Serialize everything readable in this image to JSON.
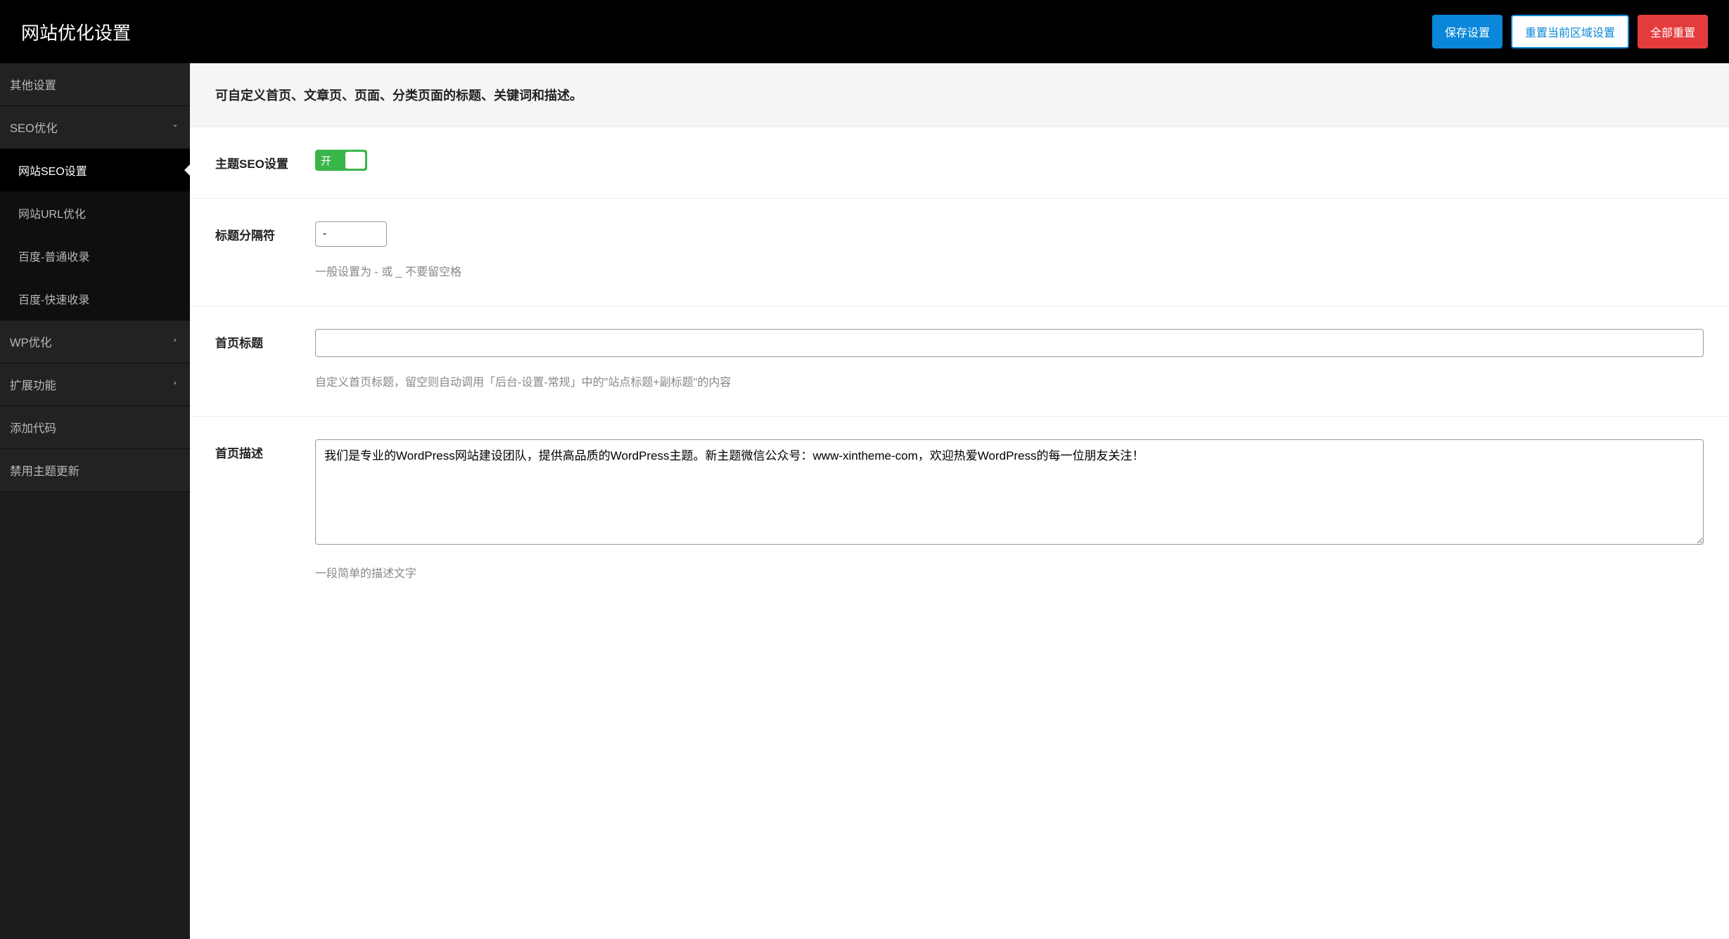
{
  "header": {
    "title": "网站优化设置",
    "actions": {
      "save": "保存设置",
      "reset_section": "重置当前区域设置",
      "reset_all": "全部重置"
    }
  },
  "sidebar": {
    "items": [
      {
        "label": "其他设置",
        "type": "item"
      },
      {
        "label": "SEO优化",
        "type": "expandable",
        "expanded": true
      },
      {
        "label": "网站SEO设置",
        "type": "subitem",
        "active": true
      },
      {
        "label": "网站URL优化",
        "type": "subitem"
      },
      {
        "label": "百度-普通收录",
        "type": "subitem"
      },
      {
        "label": "百度-快速收录",
        "type": "subitem"
      },
      {
        "label": "WP优化",
        "type": "expandable",
        "expanded": false
      },
      {
        "label": "扩展功能",
        "type": "expandable",
        "expanded": false
      },
      {
        "label": "添加代码",
        "type": "item"
      },
      {
        "label": "禁用主题更新",
        "type": "item"
      }
    ]
  },
  "content": {
    "intro": "可自定义首页、文章页、页面、分类页面的标题、关键词和描述。",
    "theme_seo": {
      "label": "主题SEO设置",
      "toggle_state": "开"
    },
    "title_separator": {
      "label": "标题分隔符",
      "value": "-",
      "help": "一般设置为 - 或 _ 不要留空格"
    },
    "home_title": {
      "label": "首页标题",
      "value": "",
      "help": "自定义首页标题，留空则自动调用「后台-设置-常规」中的\"站点标题+副标题\"的内容"
    },
    "home_description": {
      "label": "首页描述",
      "value": "我们是专业的WordPress网站建设团队，提供高品质的WordPress主题。新主题微信公众号：www-xintheme-com，欢迎热爱WordPress的每一位朋友关注！",
      "help": "一段简单的描述文字"
    }
  }
}
